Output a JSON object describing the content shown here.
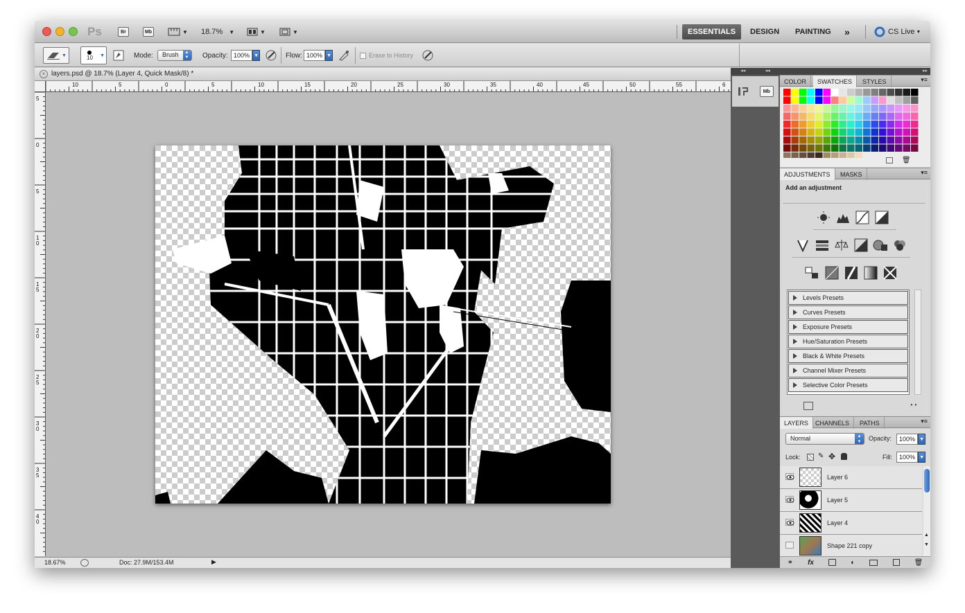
{
  "app": {
    "logo": "Ps",
    "bridge": "Br",
    "minibridge": "Mb",
    "zoom": "18.7%"
  },
  "workspaces": {
    "essentials": "ESSENTIALS",
    "design": "DESIGN",
    "painting": "PAINTING",
    "more": "»",
    "cslive": "CS Live"
  },
  "options": {
    "brush_size": "10",
    "mode_label": "Mode:",
    "mode_value": "Brush",
    "opacity_label": "Opacity:",
    "opacity_value": "100%",
    "flow_label": "Flow:",
    "flow_value": "100%",
    "erase_history": "Erase to History"
  },
  "document": {
    "tab_title": "layers.psd @ 18.7% (Layer 4, Quick Mask/8) *",
    "hruler_labels": [
      "10",
      "5",
      "0",
      "5",
      "10",
      "15",
      "20",
      "25",
      "30",
      "35",
      "40",
      "45",
      "50",
      "55",
      "6"
    ],
    "vruler_labels": [
      "5",
      "0",
      "5",
      "1 0",
      "1 5",
      "2 0",
      "2 5",
      "3 0",
      "3 5",
      "4 0"
    ]
  },
  "status": {
    "zoom": "18.67%",
    "doc": "Doc: 27.9M/153.4M"
  },
  "color_panel": {
    "tabs": [
      "COLOR",
      "SWATCHES",
      "STYLES"
    ],
    "active": "SWATCHES"
  },
  "adjustments_panel": {
    "tabs": [
      "ADJUSTMENTS",
      "MASKS"
    ],
    "heading": "Add an adjustment",
    "presets": [
      "Levels Presets",
      "Curves Presets",
      "Exposure Presets",
      "Hue/Saturation Presets",
      "Black & White Presets",
      "Channel Mixer Presets",
      "Selective Color Presets"
    ]
  },
  "layers_panel": {
    "tabs": [
      "LAYERS",
      "CHANNELS",
      "PATHS"
    ],
    "blend_mode": "Normal",
    "opacity_label": "Opacity:",
    "opacity_value": "100%",
    "lock_label": "Lock:",
    "fill_label": "Fill:",
    "fill_value": "100%",
    "layers": [
      {
        "name": "Layer 6",
        "visible": true
      },
      {
        "name": "Layer 5",
        "visible": true
      },
      {
        "name": "Layer 4",
        "visible": true
      },
      {
        "name": "Shape 221 copy",
        "visible": false
      }
    ]
  },
  "colors": {
    "accent": "#3d78d8",
    "close": "#ec5b53",
    "minimize": "#f2b230",
    "zoom_btn": "#7cc24d"
  }
}
